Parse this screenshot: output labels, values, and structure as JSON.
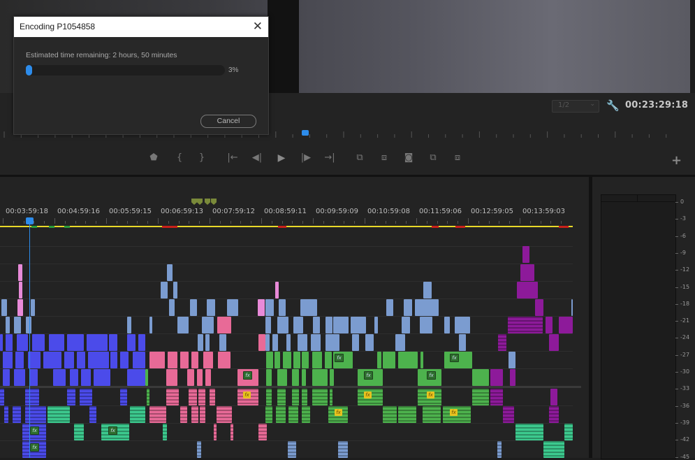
{
  "dialog": {
    "title": "Encoding P1054858",
    "close_glyph": "✕",
    "estimate": "Estimated time remaining: 2 hours, 50 minutes",
    "progress_percent": 3,
    "progress_label": "3%",
    "cancel_label": "Cancel"
  },
  "program_monitor": {
    "resolution": "1/2",
    "resolution_arrow": "⌄",
    "wrench_icon": "wrench-icon",
    "timecode": "00:23:29:18",
    "add_glyph": "+"
  },
  "transport": {
    "icons": [
      "marker-icon",
      "mark-in-icon",
      "mark-out-icon",
      "go-to-in-icon",
      "step-back-icon",
      "play-icon",
      "step-forward-icon",
      "go-to-out-icon",
      "insert-icon",
      "overwrite-icon",
      "export-frame-icon",
      "compare-icon",
      "trim-icon"
    ],
    "glyphs": [
      "⬟",
      "{",
      "}",
      "|←",
      "◀|",
      "▶",
      "|▶",
      "→|",
      "⧉",
      "⧈",
      "◙",
      "⧉",
      "⧈"
    ]
  },
  "timeline": {
    "ruler_labels": [
      "00:03:59:18",
      "00:04:59:16",
      "00:05:59:15",
      "00:06:59:13",
      "00:07:59:12",
      "00:08:59:11",
      "00:09:59:09",
      "00:10:59:08",
      "00:11:59:06",
      "00:12:59:05",
      "00:13:59:03"
    ],
    "fx_label": "fx",
    "colors": {
      "blue": "#4b4bea",
      "light_blue": "#7b9cd0",
      "pink": "#e86a97",
      "light_pink": "#e88ad8",
      "green": "#4db24d",
      "teal": "#3cc98e",
      "purple": "#8d1a9a",
      "playhead": "#2d8ceb",
      "work_area": "#e8d829"
    }
  },
  "meter": {
    "labels": [
      "0",
      "-3",
      "-6",
      "-9",
      "-12",
      "-15",
      "-18",
      "-21",
      "-24",
      "-27",
      "-30",
      "-33",
      "-36",
      "-39",
      "-42",
      "-45"
    ]
  }
}
